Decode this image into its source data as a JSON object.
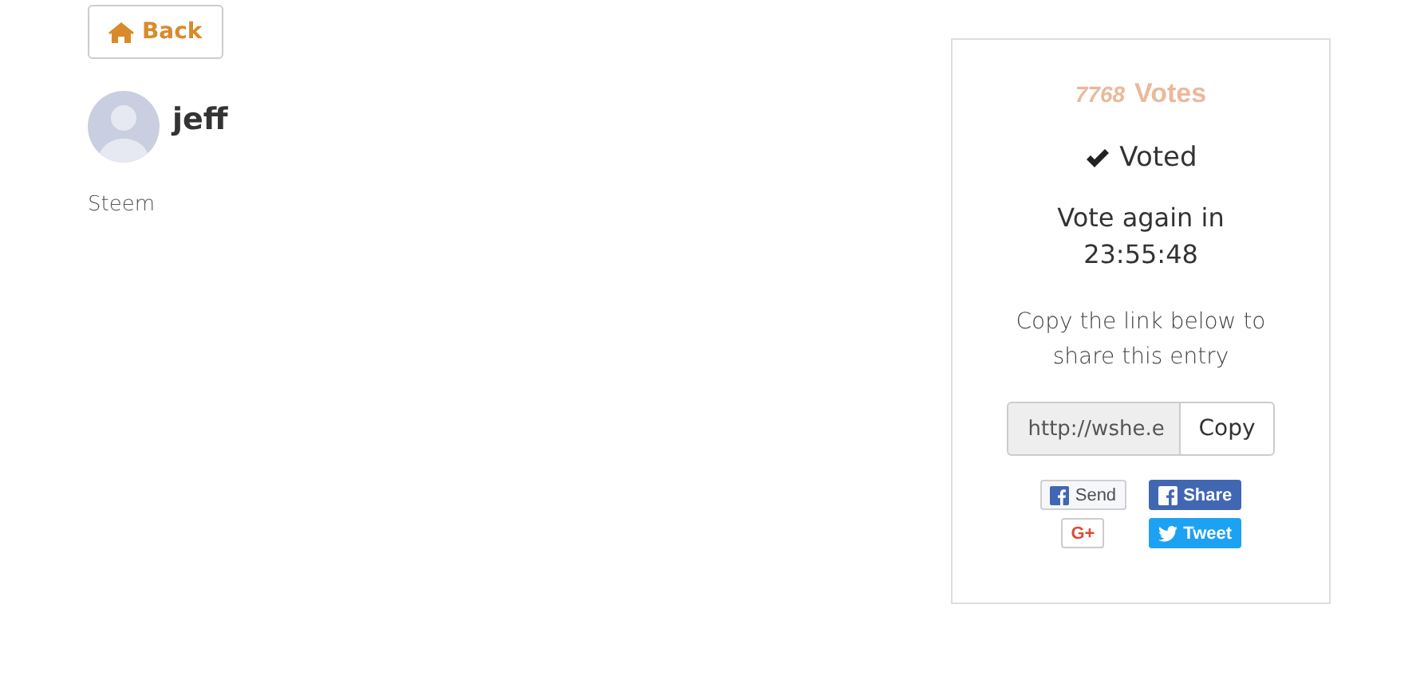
{
  "back_button": {
    "label": "Back"
  },
  "profile": {
    "name": "jeff",
    "subtitle": "Steem"
  },
  "vote_card": {
    "count": "7768",
    "count_label": "Votes",
    "status": "Voted",
    "voted": true,
    "countdown_label": "Vote again in",
    "countdown": "23:55:48",
    "share_hint": "Copy the link below to share this entry",
    "link": "http://wshe.e",
    "copy_button": "Copy",
    "share_buttons": [
      {
        "kind": "fb-send",
        "label": "Send"
      },
      {
        "kind": "fb-share",
        "label": "Share"
      },
      {
        "kind": "gplus",
        "label": "G+"
      },
      {
        "kind": "tweet",
        "label": "Tweet"
      }
    ]
  }
}
